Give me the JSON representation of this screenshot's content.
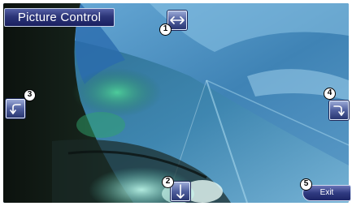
{
  "header": {
    "title": "Picture Control"
  },
  "controls": {
    "flip_horizontal": {
      "icon": "left-right-arrow-icon",
      "badge": "1"
    },
    "flip_vertical": {
      "icon": "down-arrow-icon",
      "badge": "2"
    },
    "rotate_left": {
      "icon": "rotate-left-arrow-icon",
      "badge": "3"
    },
    "rotate_right": {
      "icon": "rotate-right-arrow-icon",
      "badge": "4"
    },
    "exit": {
      "label": "Exit",
      "badge": "5"
    }
  },
  "colors": {
    "button_top": "#9aa8d6",
    "button_bottom": "#2a3772",
    "banner_bg": "#2c3578",
    "sky": "#4d8db8"
  }
}
